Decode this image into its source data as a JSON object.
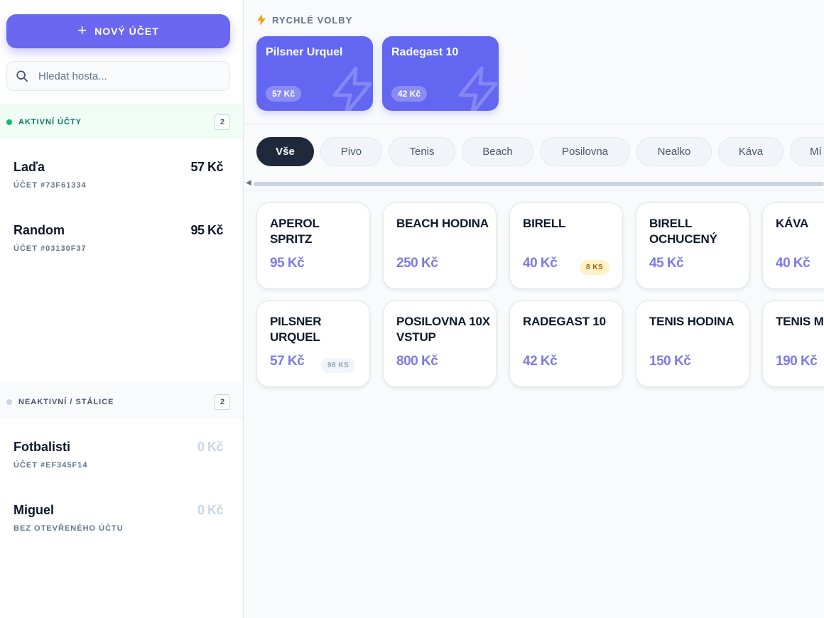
{
  "sidebar": {
    "new_account_label": "NOVÝ ÚČET",
    "search_placeholder": "Hledat hosta...",
    "active_section": {
      "title": "AKTIVNÍ ÚČTY",
      "count": "2",
      "dot_color": "#10b981"
    },
    "active_accounts": [
      {
        "name": "Laďa",
        "amount": "57 Kč",
        "sub": "ÚČET #73F61334"
      },
      {
        "name": "Random",
        "amount": "95 Kč",
        "sub": "ÚČET #03130F37"
      }
    ],
    "inactive_section": {
      "title": "NEAKTIVNÍ / STÁLICE",
      "count": "2",
      "dot_color": "#cbd5e1"
    },
    "inactive_accounts": [
      {
        "name": "Fotbalisti",
        "amount": "0 Kč",
        "sub": "ÚČET #EF345F14"
      },
      {
        "name": "Miguel",
        "amount": "0 Kč",
        "sub": "BEZ OTEVŘENÉHO ÚČTU"
      }
    ]
  },
  "quick": {
    "label": "RYCHLÉ VOLBY",
    "icon": "lightning-icon",
    "accent": "#f59e0b",
    "items": [
      {
        "name": "Pilsner Urquel",
        "price": "57 Kč"
      },
      {
        "name": "Radegast 10",
        "price": "42 Kč"
      }
    ]
  },
  "categories": {
    "active_index": 0,
    "items": [
      "Vše",
      "Pivo",
      "Tenis",
      "Beach",
      "Posilovna",
      "Nealko",
      "Káva",
      "Mí"
    ]
  },
  "products": [
    {
      "name": "APEROL SPRITZ",
      "price": "95 Kč",
      "stock": ""
    },
    {
      "name": "BEACH HODINA",
      "price": "250 Kč",
      "stock": ""
    },
    {
      "name": "BIRELL",
      "price": "40 Kč",
      "stock": "8 KS",
      "stock_level": "low"
    },
    {
      "name": "BIRELL OCHUCENÝ",
      "price": "45 Kč",
      "stock": ""
    },
    {
      "name": "KÁVA",
      "price": "40 Kč",
      "stock": ""
    },
    {
      "name": "PILSNER URQUEL",
      "price": "57 Kč",
      "stock": "98 KS",
      "stock_level": "ok"
    },
    {
      "name": "POSILOVNA 10X VSTUP",
      "price": "800 Kč",
      "stock": ""
    },
    {
      "name": "RADEGAST 10",
      "price": "42 Kč",
      "stock": ""
    },
    {
      "name": "TENIS HODINA",
      "price": "150 Kč",
      "stock": ""
    },
    {
      "name": "TENIS M",
      "price": "190 Kč",
      "stock": ""
    }
  ],
  "colors": {
    "brand": "#6a67f0",
    "price": "#7c7ae8",
    "dark": "#1e293b"
  }
}
